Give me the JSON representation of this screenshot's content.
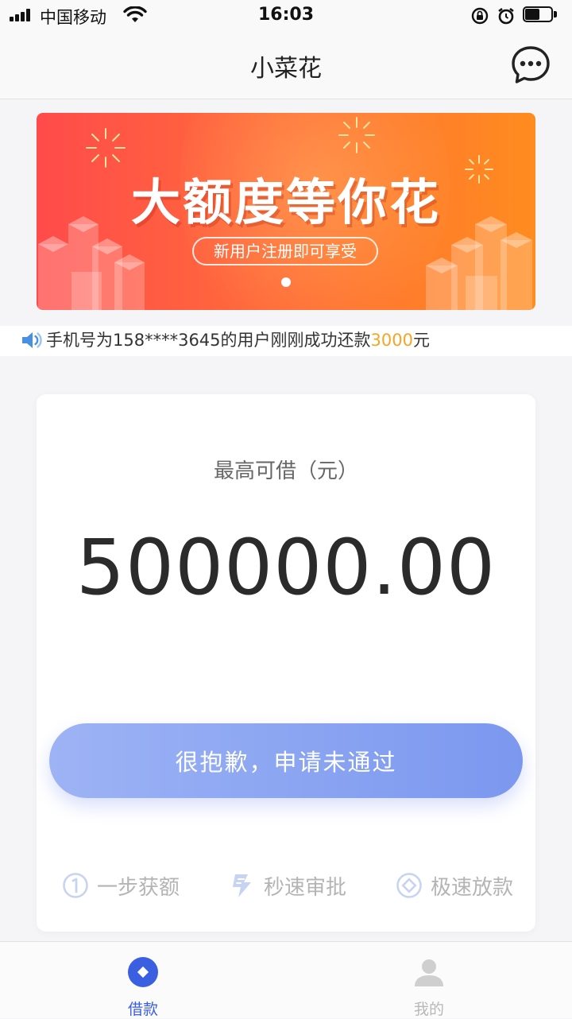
{
  "status_bar": {
    "carrier": "中国移动",
    "time": "16:03",
    "battery_level": 0.55
  },
  "nav": {
    "title": "小菜花",
    "action_icon": "chat-bubble-icon"
  },
  "banner": {
    "title": "大额度等你花",
    "subtitle": "新用户注册即可享受",
    "colors": {
      "start": "#ff4b4b",
      "end": "#ff8c1f"
    }
  },
  "notice": {
    "icon": "speaker-icon",
    "text_prefix": "手机号为158****3645的用户刚刚成功还款",
    "amount": "3000",
    "unit": "元"
  },
  "loan_card": {
    "limit_label": "最高可借（元）",
    "limit_amount": "500000.00",
    "apply_button": "很抱歉，申请未通过",
    "features": [
      {
        "icon": "number-one-circle-icon",
        "label": "一步获额"
      },
      {
        "icon": "lightning-icon",
        "label": "秒速审批"
      },
      {
        "icon": "diamond-circle-icon",
        "label": "极速放款"
      }
    ]
  },
  "tabs": [
    {
      "icon": "diamond-circle-icon",
      "label": "借款",
      "active": true
    },
    {
      "icon": "person-icon",
      "label": "我的",
      "active": false
    }
  ],
  "colors": {
    "accent": "#3a5fe0",
    "highlight": "#f5a623",
    "button_start": "#9db3f5",
    "button_end": "#7b98ef"
  }
}
